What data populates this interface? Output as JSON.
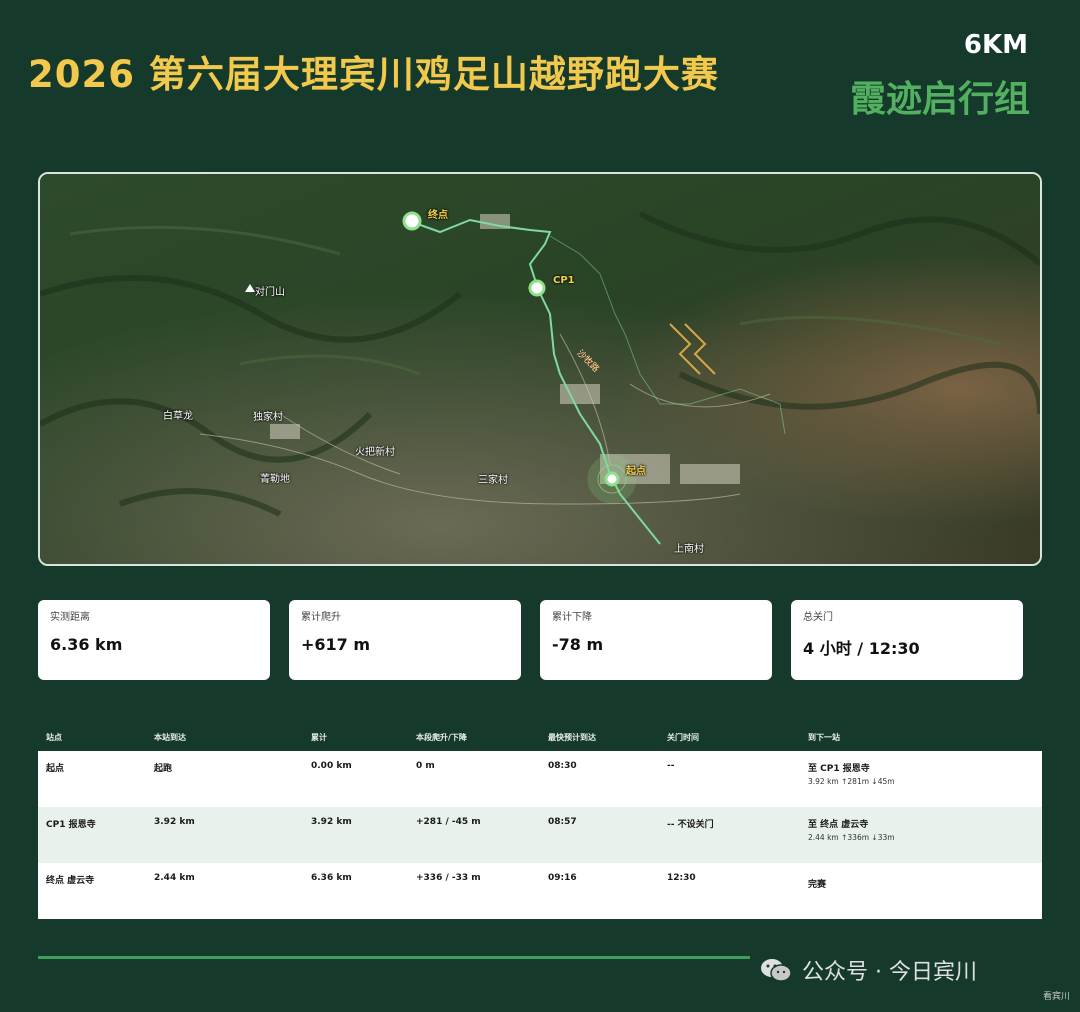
{
  "header": {
    "title": "2026 第六届大理宾川鸡足山越野跑大赛",
    "distance": "6KM",
    "group": "霞迹启行组"
  },
  "map": {
    "labels": {
      "finish": "终点",
      "cp1": "CP1",
      "start": "起点",
      "mountain": "对门山",
      "road": "沙牧路",
      "baicaolong": "白草龙",
      "dujiacun": "独家村",
      "huobaxincun": "火把新村",
      "qinlediad": "菁勒地",
      "sanjiacun": "三家村",
      "shangnancun": "上南村"
    },
    "colors": {
      "route": "#7fd9a0",
      "marker": "#8ee08a"
    }
  },
  "stats": [
    {
      "label": "实测距离",
      "value": "6.36 km"
    },
    {
      "label": "累计爬升",
      "value": "+617 m"
    },
    {
      "label": "累计下降",
      "value": "-78 m"
    },
    {
      "label": "总关门",
      "value": "4 小时 / 12:30"
    }
  ],
  "table": {
    "headers": [
      "站点",
      "本站到达",
      "累计",
      "本段爬升/下降",
      "最快预计到达",
      "关门时间",
      "到下一站"
    ],
    "rows": [
      {
        "station": "起点",
        "arrive": "起跑",
        "cumulative": "0.00 km",
        "gain": "0 m",
        "eta": "08:30",
        "cutoff": "--",
        "next": "至 CP1 报恩寺",
        "next_sub": "3.92 km ↑281m ↓45m"
      },
      {
        "station": "CP1 报恩寺",
        "arrive": "3.92 km",
        "cumulative": "3.92 km",
        "gain": "+281 / -45 m",
        "eta": "08:57",
        "cutoff": "-- 不设关门",
        "next": "至 终点 虚云寺",
        "next_sub": "2.44 km ↑336m ↓33m"
      },
      {
        "station": "终点 虚云寺",
        "arrive": "2.44 km",
        "cumulative": "6.36 km",
        "gain": "+336 / -33 m",
        "eta": "09:16",
        "cutoff": "12:30",
        "next": "完赛",
        "next_sub": ""
      }
    ]
  },
  "watermark": {
    "main": "公众号 · 今日宾川",
    "corner": "看宾川",
    "icon": "wechat-icon"
  }
}
